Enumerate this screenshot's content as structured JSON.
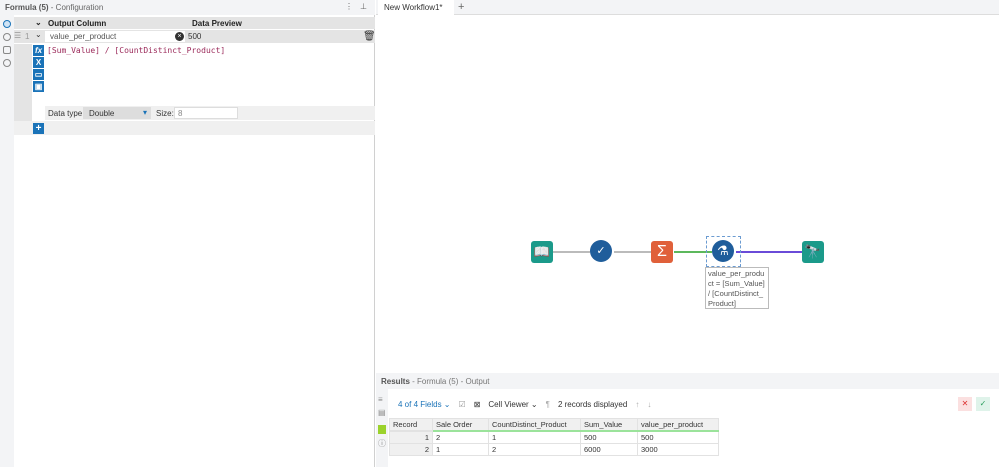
{
  "config": {
    "title": "Formula (5)",
    "subtitle": "- Configuration",
    "col_output": "Output Column",
    "col_preview": "Data Preview",
    "row_num": "1",
    "field_name": "value_per_product",
    "preview": "500",
    "expression": "[Sum_Value] / [CountDistinct_Product]",
    "datatype_label": "Data type:",
    "datatype": "Double",
    "size_label": "Size:",
    "size": "8"
  },
  "tabs": {
    "workflow": "New Workflow1*",
    "add": "+"
  },
  "annotation": "value_per_product = [Sum_Value] / [CountDistinct_Product]",
  "results": {
    "title": "Results",
    "subtitle": "- Formula (5) - Output",
    "fields": "4 of 4 Fields",
    "viewer": "Cell Viewer",
    "count": "2 records displayed",
    "columns": [
      "Record",
      "Sale Order",
      "CountDistinct_Product",
      "Sum_Value",
      "value_per_product"
    ],
    "rows": [
      [
        "1",
        "2",
        "1",
        "500",
        "500"
      ],
      [
        "2",
        "1",
        "2",
        "6000",
        "3000"
      ]
    ]
  },
  "colors": {
    "accent": "#1a73b8",
    "input": "#1b9a8a",
    "summarize": "#e0603a"
  }
}
